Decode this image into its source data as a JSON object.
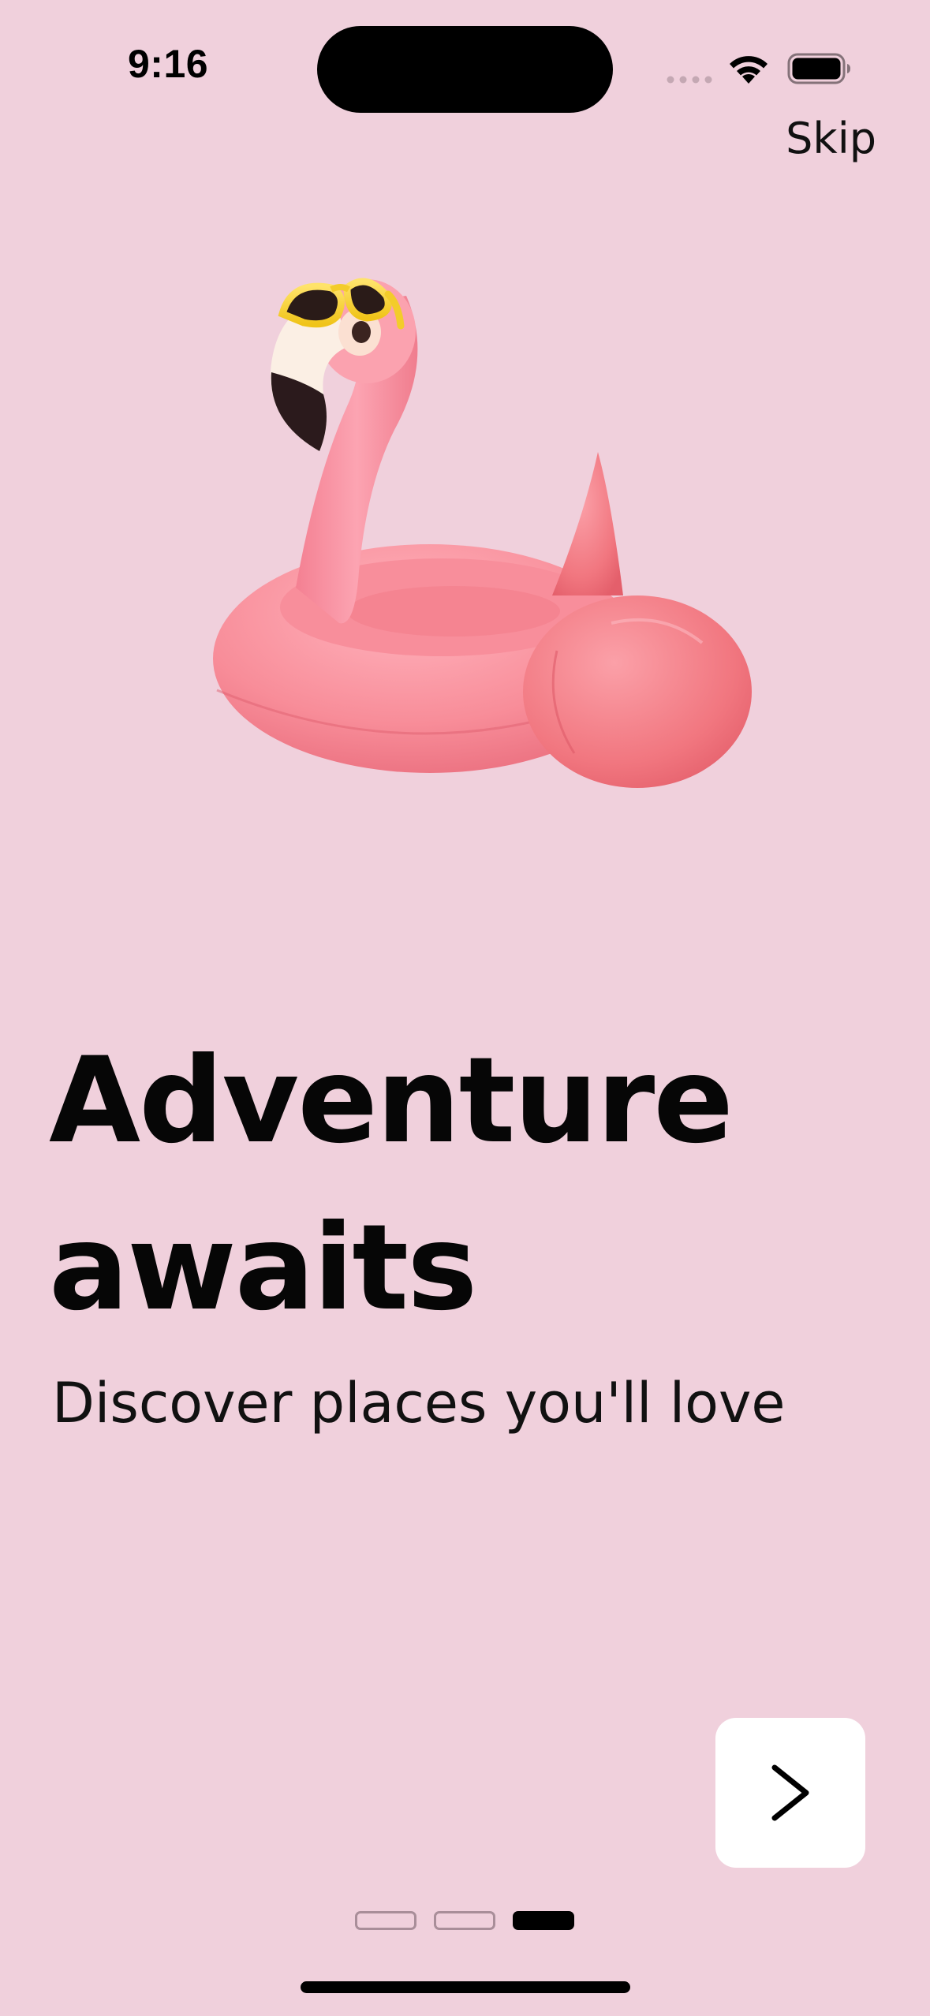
{
  "status_bar": {
    "time": "9:16"
  },
  "header": {
    "skip_label": "Skip"
  },
  "onboarding": {
    "illustration_icon": "inflatable-flamingo-float",
    "headline_line1": "Adventure",
    "headline_line2": "awaits",
    "subtitle": "Discover places you'll love",
    "next_icon": "chevron-right-icon"
  },
  "pager": {
    "total_pages": 3,
    "current_page": 3
  },
  "colors": {
    "background": "#f0d0dc",
    "flamingo": "#f58fa0",
    "button": "#ffffff"
  }
}
